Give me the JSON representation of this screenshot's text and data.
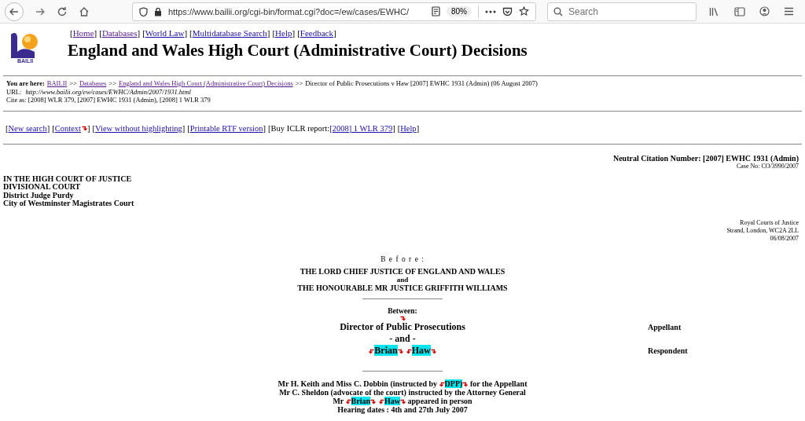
{
  "browser": {
    "url": "https://www.bailii.org/cgi-bin/format.cgi?doc=/ew/cases/EWHC/",
    "zoom": "80%",
    "search_placeholder": "Search"
  },
  "site": {
    "logo_text": "BAILII",
    "title": "England and Wales High Court (Administrative Court) Decisions",
    "nav": [
      {
        "label": "Home",
        "visited": true
      },
      {
        "label": "Databases",
        "visited": true
      },
      {
        "label": "World Law",
        "visited": false
      },
      {
        "label": "Multidatabase Search",
        "visited": false
      },
      {
        "label": "Help",
        "visited": false
      },
      {
        "label": "Feedback",
        "visited": false
      }
    ],
    "brackets": [
      "[",
      "]"
    ]
  },
  "breadcrumb": {
    "label": "You are here:",
    "separator": ">>",
    "links": [
      {
        "label": "BAILII"
      },
      {
        "label": "Databases"
      },
      {
        "label": "England and Wales High Court (Administrative Court) Decisions"
      }
    ],
    "current": "Director of Public Prosecutions v Haw [2007] EWHC 1931 (Admin) (06 August 2007)"
  },
  "url_line": {
    "label": "URL:",
    "value": "http://www.bailii.org/ew/cases/EWHC/Admin/2007/1931.html"
  },
  "cite_line": "Cite as: [2008] WLR 379, [2007] EWHC 1931 (Admin), [2008] 1 WLR 379",
  "actions": [
    {
      "kind": "link",
      "label": "New search",
      "marker": false
    },
    {
      "kind": "link",
      "label": "Context",
      "marker": true
    },
    {
      "kind": "link",
      "label": "View without highlighting",
      "marker": false
    },
    {
      "kind": "link",
      "label": "Printable RTF version",
      "marker": false
    },
    {
      "kind": "text-link",
      "text": "Buy ICLR report:",
      "label": "[2008] 1 WLR 379",
      "marker": false
    },
    {
      "kind": "link",
      "label": "Help",
      "marker": false
    }
  ],
  "judgment": {
    "neutral_citation": "Neutral Citation Number: [2007] EWHC 1931 (Admin)",
    "case_no": "Case No: CO/3990/2007",
    "court_lines": [
      "IN THE HIGH COURT OF JUSTICE",
      "DIVISIONAL COURT",
      "District Judge Purdy",
      "City of Westminster Magistrates Court"
    ],
    "address_lines": [
      "Royal Courts of Justice",
      "Strand, London, WC2A 2LL",
      "06/08/2007"
    ],
    "before": "B e f o r e :",
    "judges": [
      {
        "text": "THE LORD CHIEF JUSTICE OF ENGLAND AND WALES",
        "kind": "name"
      },
      {
        "text": "and",
        "kind": "joiner"
      },
      {
        "text": "THE HONOURABLE MR JUSTICE GRIFFITH WILLIAMS",
        "kind": "name"
      }
    ],
    "between": "Between:",
    "parties": [
      {
        "kind": "party",
        "segments": [
          {
            "text": "Director of Public Prosecutions",
            "hit": false
          }
        ],
        "role": "Appellant"
      },
      {
        "kind": "joiner",
        "segments": [
          {
            "text": "- and -",
            "hit": false
          }
        ]
      },
      {
        "kind": "party",
        "segments": [
          {
            "text": "Brian",
            "hit": true
          },
          {
            "text": "Haw",
            "hit": true
          }
        ],
        "role": "Respondent"
      }
    ],
    "appearances": [
      [
        {
          "text": "Mr H. Keith and Miss C. Dobbin (instructed by ",
          "hit": false
        },
        {
          "text": "DPP)",
          "hit": true
        },
        {
          "text": " for the Appellant",
          "hit": false
        }
      ],
      [
        {
          "text": "Mr C. Sheldon (advocate of the court) instructed by the Attorney General",
          "hit": false
        }
      ],
      [
        {
          "text": "Mr ",
          "hit": false
        },
        {
          "text": "Brian",
          "hit": true
        },
        {
          "text": "Haw",
          "hit": true
        },
        {
          "text": " appeared in person",
          "hit": false
        }
      ],
      [
        {
          "text": "Hearing dates : 4th and 27th July 2007",
          "hit": false
        }
      ]
    ]
  }
}
